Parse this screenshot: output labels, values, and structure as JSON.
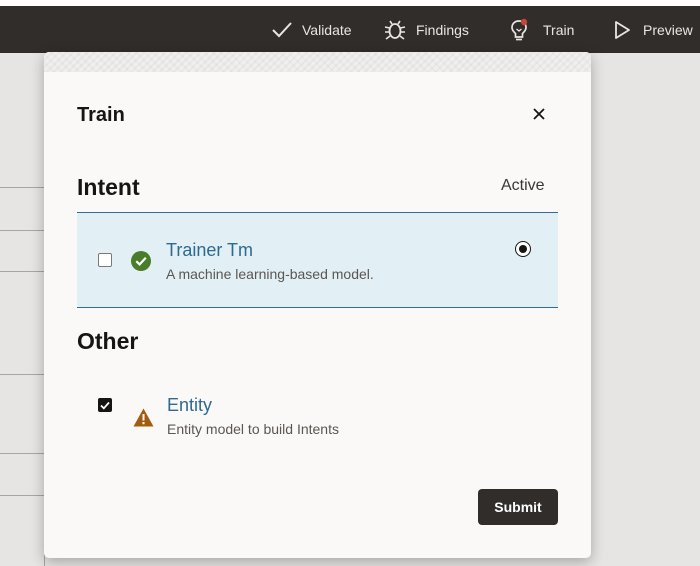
{
  "toolbar": {
    "items": [
      {
        "label": "Validate",
        "icon": "check-icon"
      },
      {
        "label": "Findings",
        "icon": "bug-icon"
      },
      {
        "label": "Train",
        "icon": "lightbulb-icon",
        "badge_color": "#c74634"
      },
      {
        "label": "Preview",
        "icon": "play-icon"
      }
    ]
  },
  "dialog": {
    "title": "Train",
    "close_icon": "close-icon",
    "intent_section": {
      "title": "Intent",
      "active_label": "Active",
      "items": [
        {
          "name": "Trainer Tm",
          "description": "A machine learning-based model.",
          "checked": false,
          "status_icon": "success-check-icon",
          "status_color": "#4a7d2a",
          "active": true
        }
      ]
    },
    "other_section": {
      "title": "Other",
      "items": [
        {
          "name": "Entity",
          "description": "Entity model to build Intents",
          "checked": true,
          "status_icon": "warning-icon",
          "status_color": "#a35b0f"
        }
      ]
    },
    "submit_label": "Submit"
  },
  "colors": {
    "topbar": "#312d2a",
    "link": "#2c6a8f",
    "selected_row": "#e2f0f6",
    "selected_border": "#2d6e8e"
  }
}
